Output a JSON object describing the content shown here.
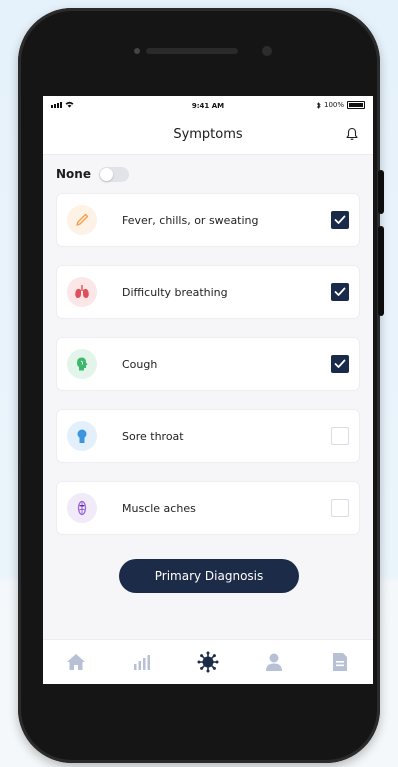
{
  "status_bar": {
    "time": "9:41 AM",
    "battery": "100%"
  },
  "header": {
    "title": "Symptoms"
  },
  "none_toggle": {
    "label": "None",
    "on": false
  },
  "symptoms": [
    {
      "label": "Fever, chills, or sweating",
      "checked": true,
      "icon": "thermometer-icon",
      "color": "#f4a04a"
    },
    {
      "label": "Difficulty breathing",
      "checked": true,
      "icon": "lungs-icon",
      "color": "#e0505a"
    },
    {
      "label": "Cough",
      "checked": true,
      "icon": "cough-icon",
      "color": "#3cb86a"
    },
    {
      "label": "Sore throat",
      "checked": false,
      "icon": "throat-icon",
      "color": "#3a96e0"
    },
    {
      "label": "Muscle aches",
      "checked": false,
      "icon": "muscle-icon",
      "color": "#9b6ad6"
    }
  ],
  "primary_button": {
    "label": "Primary Diagnosis"
  },
  "tabs": [
    {
      "name": "home-icon",
      "active": false
    },
    {
      "name": "chart-icon",
      "active": false
    },
    {
      "name": "virus-icon",
      "active": true
    },
    {
      "name": "profile-icon",
      "active": false
    },
    {
      "name": "document-icon",
      "active": false
    }
  ],
  "colors": {
    "accent": "#1c2b48",
    "inactive": "#b8c0d6"
  }
}
